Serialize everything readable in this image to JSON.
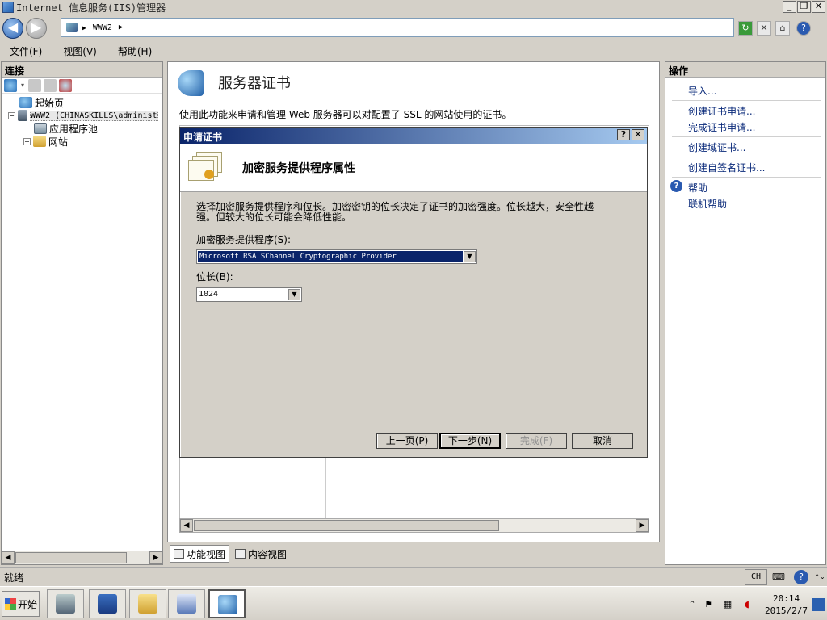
{
  "window": {
    "title": "Internet 信息服务(IIS)管理器",
    "minimize": "_",
    "restore": "❐",
    "close": "✕"
  },
  "address": {
    "crumb": "WWW2",
    "sep1": "▶",
    "sep2": "▶"
  },
  "menu": {
    "file": "文件(F)",
    "view": "视图(V)",
    "help": "帮助(H)"
  },
  "connections": {
    "header": "连接",
    "tree": [
      {
        "label": "起始页"
      },
      {
        "label": "WWW2 (CHINASKILLS\\administ",
        "expander": "−"
      },
      {
        "label": "应用程序池"
      },
      {
        "label": "网站",
        "expander": "+"
      }
    ]
  },
  "feature": {
    "title": "服务器证书",
    "description": "使用此功能来申请和管理 Web 服务器可以对配置了 SSL 的网站使用的证书。"
  },
  "view_tabs": {
    "features": "功能视图",
    "content": "内容视图"
  },
  "actions": {
    "header": "操作",
    "items": [
      "导入...",
      "创建证书申请...",
      "完成证书申请...",
      "创建域证书...",
      "创建自签名证书...",
      "帮助",
      "联机帮助"
    ]
  },
  "dialog": {
    "title": "申请证书",
    "help_btn": "?",
    "close_btn": "✕",
    "heading": "加密服务提供程序属性",
    "description": "选择加密服务提供程序和位长。加密密钥的位长决定了证书的加密强度。位长越大，安全性越强。但较大的位长可能会降低性能。",
    "provider_label": "加密服务提供程序(S):",
    "provider_value": "Microsoft RSA SChannel Cryptographic Provider",
    "bitlength_label": "位长(B):",
    "bitlength_value": "1024",
    "buttons": {
      "prev": "上一页(P)",
      "next": "下一步(N)",
      "finish": "完成(F)",
      "cancel": "取消"
    }
  },
  "status": {
    "text": "就绪",
    "lang": "CH"
  },
  "taskbar": {
    "start": "开始",
    "time": "20:14",
    "date": "2015/2/7"
  }
}
